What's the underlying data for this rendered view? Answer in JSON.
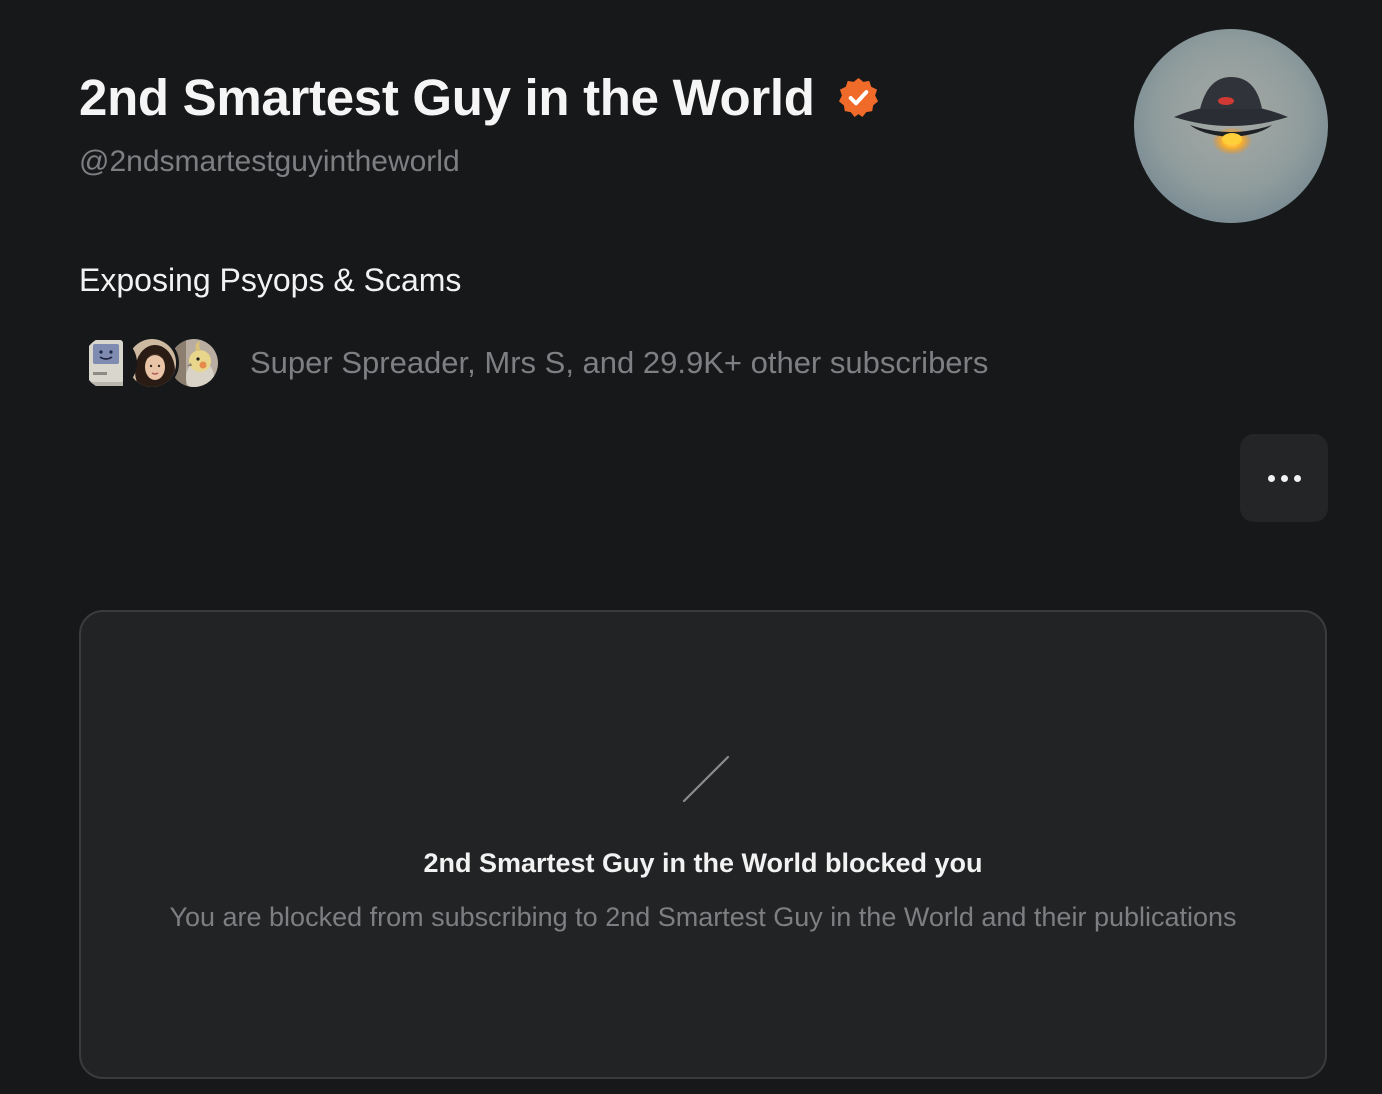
{
  "profile": {
    "name": "2nd Smartest Guy in the World",
    "handle": "@2ndsmartestguyintheworld",
    "bio": "Exposing Psyops & Scams",
    "verified": true,
    "badge_color": "#f06a2a"
  },
  "subscribers": {
    "text": "Super Spreader, Mrs S, and 29.9K+ other subscribers",
    "avatars": [
      "retro-computer-avatar",
      "woman-portrait-avatar",
      "cockatiel-bird-avatar"
    ]
  },
  "actions": {
    "more_icon": "ellipsis-icon"
  },
  "blocked": {
    "title": "2nd Smartest Guy in the World blocked you",
    "message": "You are blocked from subscribing to 2nd Smartest Guy in the World and their publications",
    "icon": "slash-icon"
  },
  "colors": {
    "background": "#17181a",
    "card": "#222324",
    "muted_text": "#7d7f82",
    "accent": "#f06a2a"
  }
}
